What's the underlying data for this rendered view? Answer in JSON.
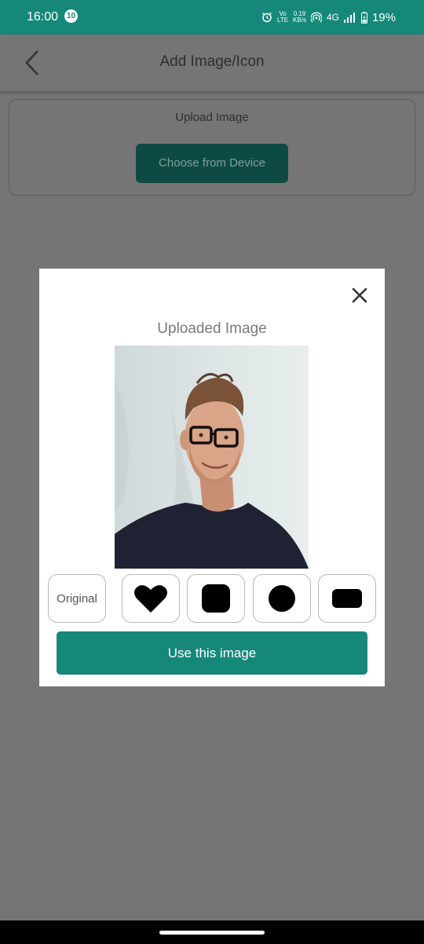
{
  "status_bar": {
    "time": "16:00",
    "notification_count": "10",
    "volte_top": "Vo",
    "volte_bottom": "LTE",
    "speed_value": "0.19",
    "speed_unit": "KB/s",
    "network": "4G",
    "battery": "19%"
  },
  "page": {
    "title": "Add Image/Icon",
    "upload_card": {
      "label": "Upload Image",
      "button": "Choose from Device"
    }
  },
  "modal": {
    "title": "Uploaded Image",
    "shape_options": {
      "original": "Original",
      "icons": [
        "heart-shape",
        "rounded-square-shape",
        "circle-shape",
        "rounded-rectangle-shape"
      ]
    },
    "use_button": "Use this image"
  },
  "colors": {
    "accent": "#15887a",
    "overlay": "#757575"
  }
}
